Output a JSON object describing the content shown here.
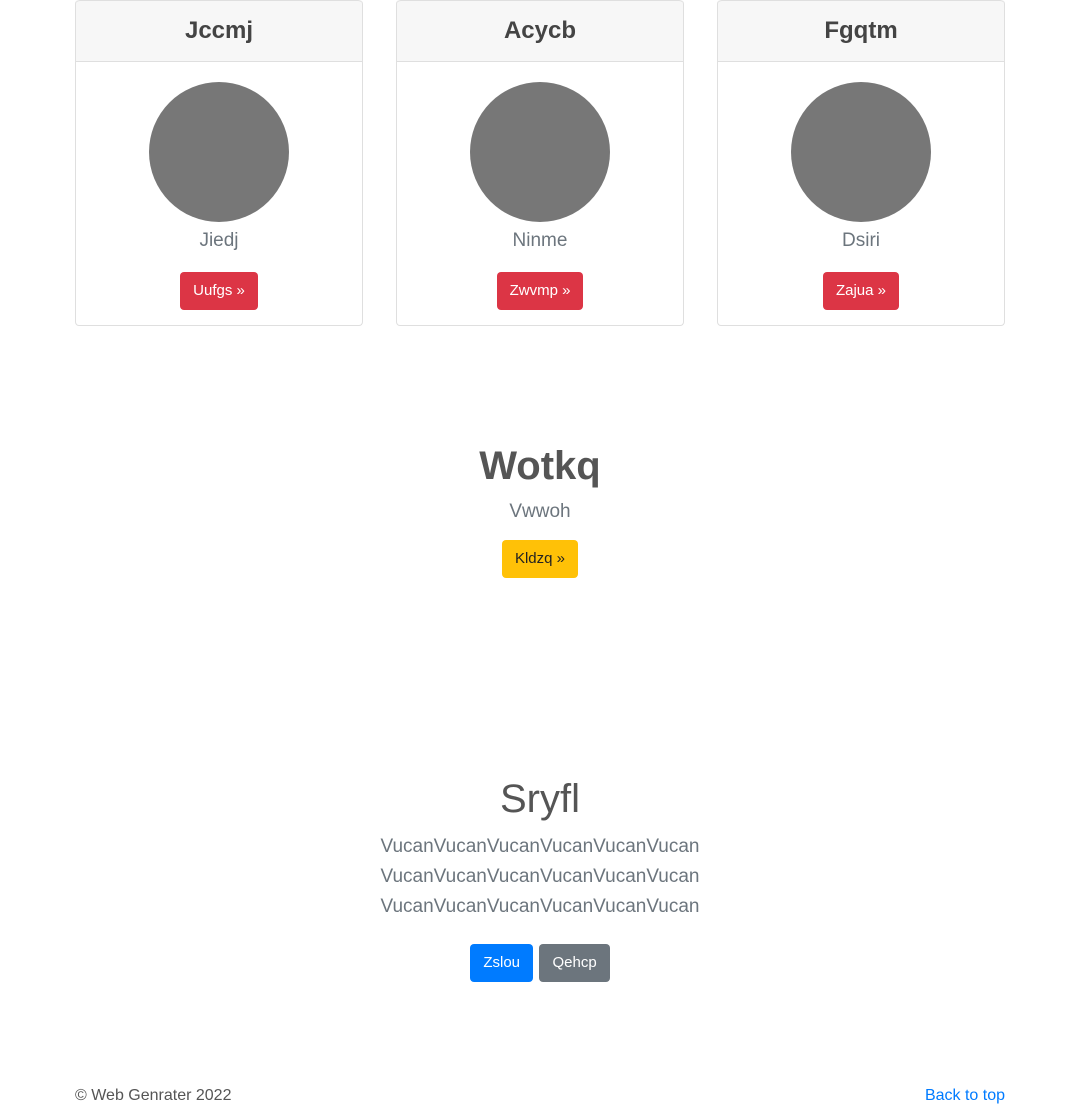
{
  "cards": [
    {
      "title": "Jccmj",
      "subtitle": "Jiedj",
      "button": "Uufgs »"
    },
    {
      "title": "Acycb",
      "subtitle": "Ninme",
      "button": "Zwvmp »"
    },
    {
      "title": "Fgqtm",
      "subtitle": "Dsiri",
      "button": "Zajua »"
    }
  ],
  "feature": {
    "heading": "Wotkq",
    "subtitle": "Vwwoh",
    "button": "Kldzq »"
  },
  "hero": {
    "heading": "Sryfl",
    "lead": "VucanVucanVucanVucanVucanVucanVucanVucanVucanVucanVucanVucanVucanVucanVucanVucanVucanVucan",
    "primary_button": "Zslou",
    "secondary_button": "Qehcp"
  },
  "footer": {
    "copyright": "© Web Genrater 2022",
    "back_to_top": "Back to top"
  },
  "colors": {
    "danger": "#dc3545",
    "warning": "#ffc107",
    "primary": "#007bff",
    "secondary": "#6c757d",
    "avatar": "#777777"
  },
  "icons": {
    "avatar": "avatar-placeholder-circle"
  }
}
